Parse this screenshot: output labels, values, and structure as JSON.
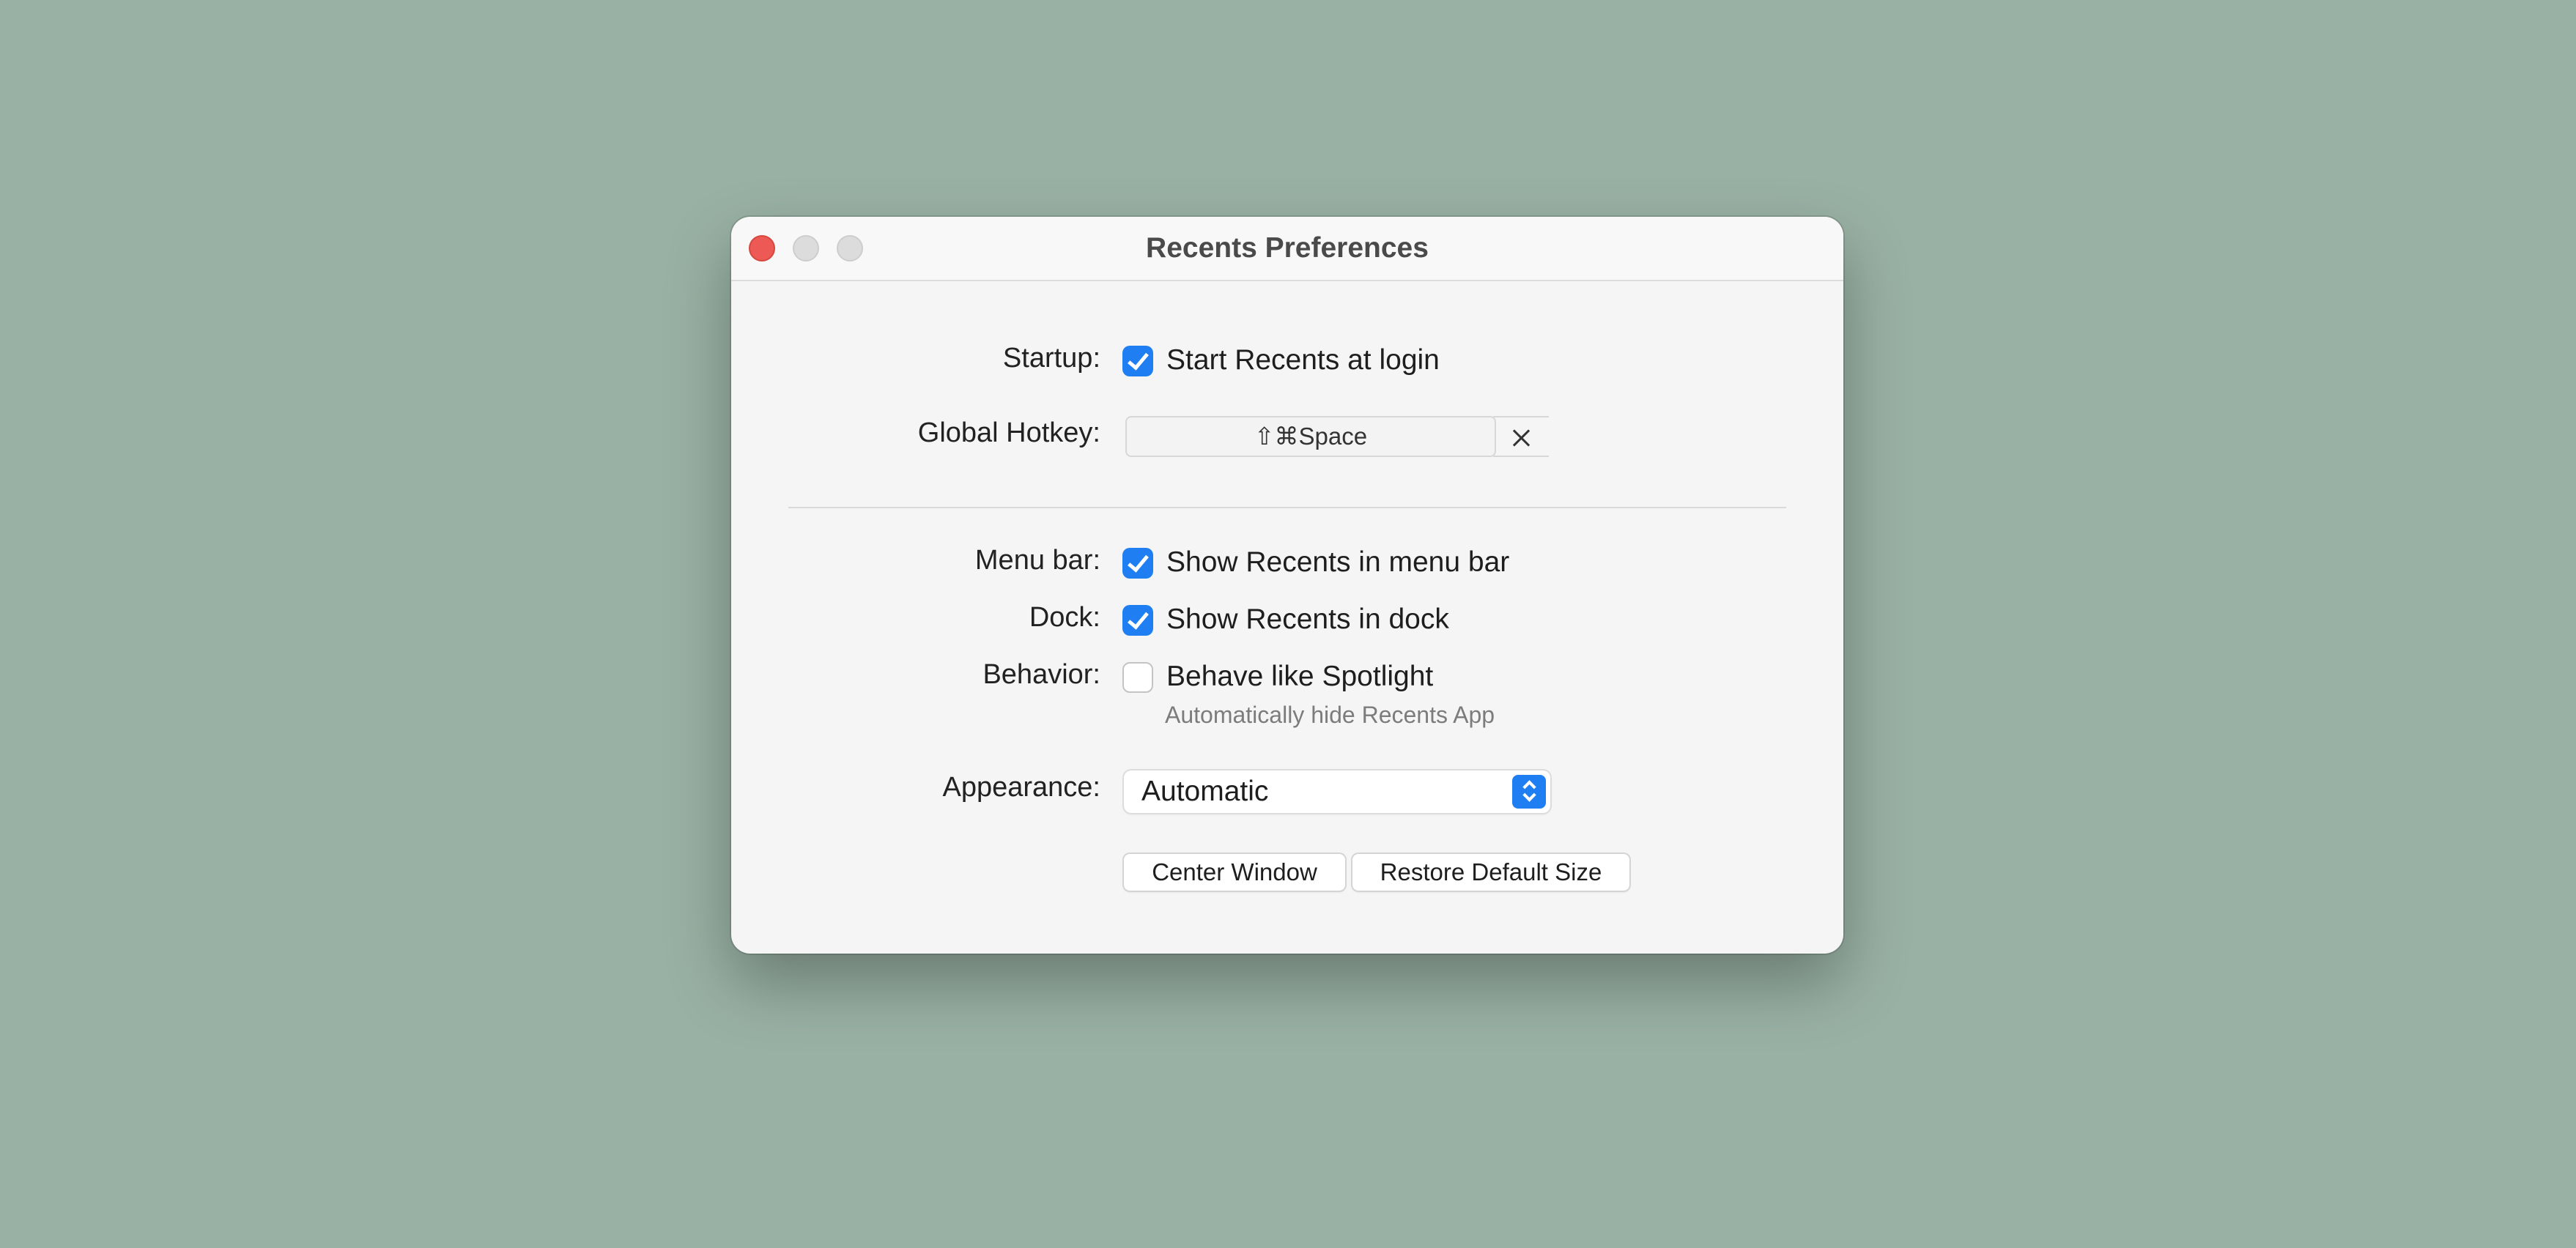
{
  "window": {
    "title": "Recents Preferences"
  },
  "startup": {
    "label": "Startup:",
    "checkbox_label": "Start Recents at login",
    "checked": true
  },
  "hotkey": {
    "label": "Global Hotkey:",
    "value": "⇧⌘Space",
    "clear_icon": "close-icon"
  },
  "menu_bar": {
    "label": "Menu bar:",
    "checkbox_label": "Show Recents in menu bar",
    "checked": true
  },
  "dock": {
    "label": "Dock:",
    "checkbox_label": "Show Recents in dock",
    "checked": true
  },
  "behavior": {
    "label": "Behavior:",
    "checkbox_label": "Behave like Spotlight",
    "checked": false,
    "hint": "Automatically hide Recents App"
  },
  "appearance": {
    "label": "Appearance:",
    "selected": "Automatic"
  },
  "buttons": {
    "center": "Center Window",
    "restore": "Restore Default Size"
  },
  "colors": {
    "background": "#99b1a4",
    "accent": "#1f7ff2",
    "close": "#ed5a55"
  }
}
